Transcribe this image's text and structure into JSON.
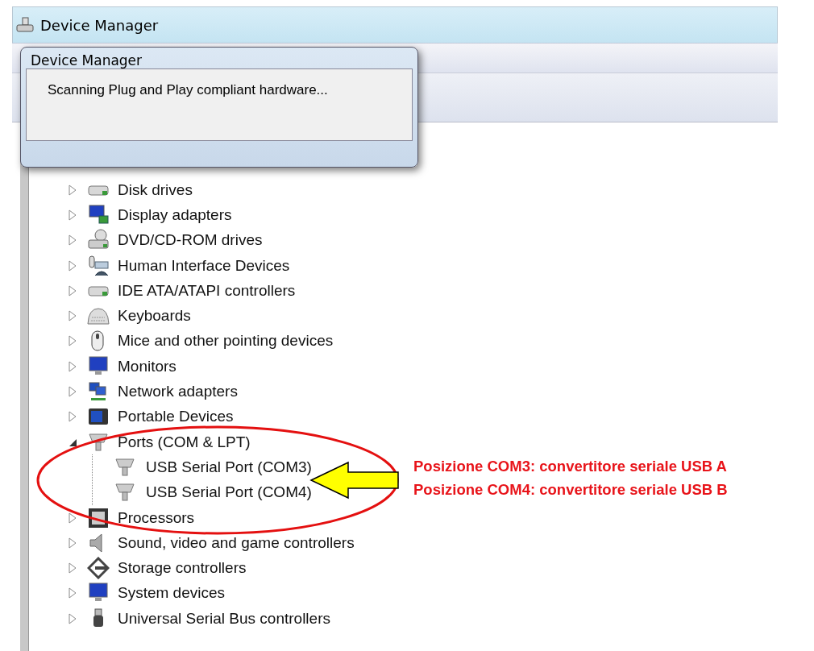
{
  "window": {
    "title": "Device Manager"
  },
  "dialog": {
    "title": "Device Manager",
    "message": "Scanning Plug and Play compliant hardware..."
  },
  "tree": [
    {
      "label": "Disk drives",
      "kind": "drive",
      "expanded": false
    },
    {
      "label": "Display adapters",
      "kind": "display",
      "expanded": false
    },
    {
      "label": "DVD/CD-ROM drives",
      "kind": "disc",
      "expanded": false
    },
    {
      "label": "Human Interface Devices",
      "kind": "hid",
      "expanded": false
    },
    {
      "label": "IDE ATA/ATAPI controllers",
      "kind": "drive",
      "expanded": false
    },
    {
      "label": "Keyboards",
      "kind": "keyboard",
      "expanded": false
    },
    {
      "label": "Mice and other pointing devices",
      "kind": "mouse",
      "expanded": false
    },
    {
      "label": "Monitors",
      "kind": "monitor",
      "expanded": false
    },
    {
      "label": "Network adapters",
      "kind": "network",
      "expanded": false
    },
    {
      "label": "Portable Devices",
      "kind": "portable",
      "expanded": false
    },
    {
      "label": "Ports (COM & LPT)",
      "kind": "port",
      "expanded": true,
      "children": [
        {
          "label": "USB Serial Port (COM3)",
          "kind": "port"
        },
        {
          "label": "USB Serial Port (COM4)",
          "kind": "port"
        }
      ]
    },
    {
      "label": "Processors",
      "kind": "chip",
      "expanded": false
    },
    {
      "label": "Sound, video and game controllers",
      "kind": "speaker",
      "expanded": false
    },
    {
      "label": "Storage controllers",
      "kind": "storage",
      "expanded": false
    },
    {
      "label": "System devices",
      "kind": "monitor",
      "expanded": false
    },
    {
      "label": "Universal Serial Bus controllers",
      "kind": "usb",
      "expanded": false
    }
  ],
  "annotations": [
    "Posizione COM3: convertitore seriale USB A",
    "Posizione COM4: convertitore seriale USB B"
  ]
}
